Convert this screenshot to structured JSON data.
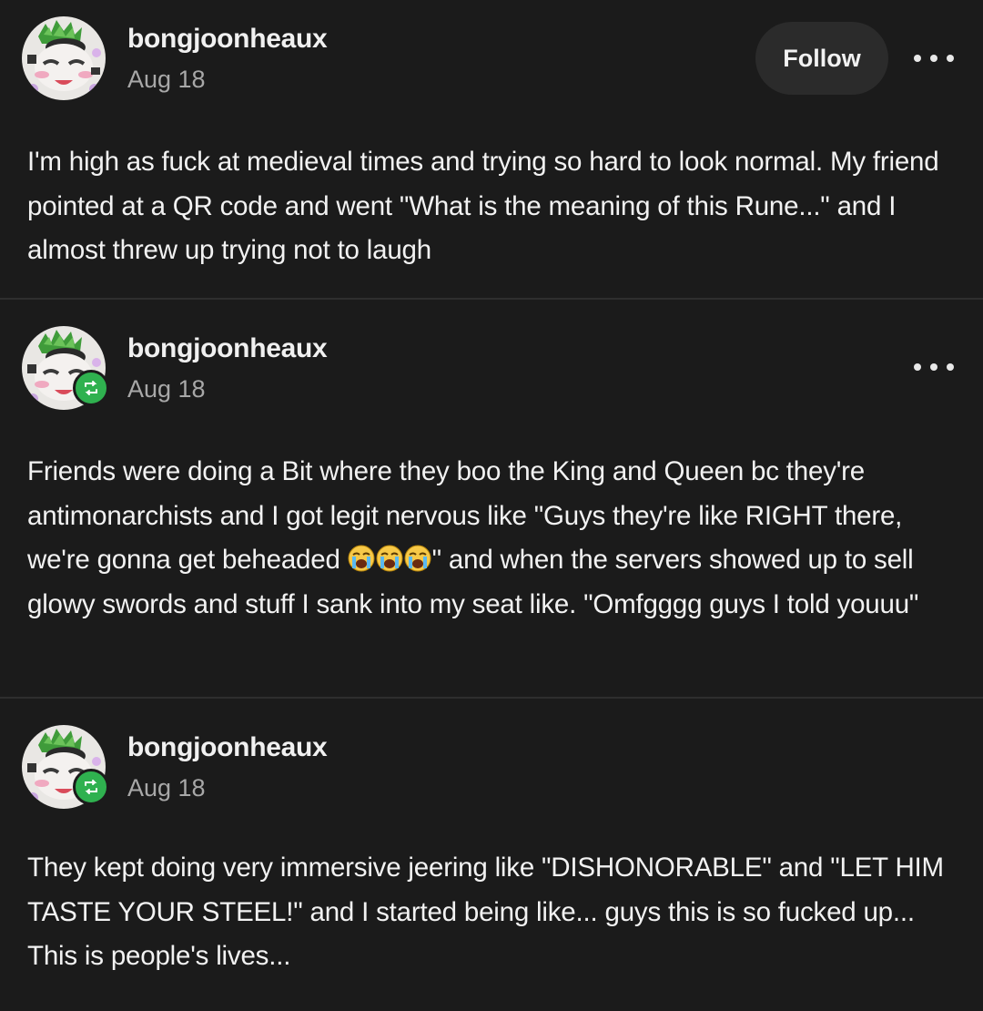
{
  "posts": [
    {
      "username": "bongjoonheaux",
      "date": "Aug 18",
      "follow_label": "Follow",
      "reblog": false,
      "body": "I'm high as fuck at medieval times and trying so hard to look normal. My friend pointed at a QR code and went \"What is the meaning of this Rune...\" and I almost threw up trying not to laugh"
    },
    {
      "username": "bongjoonheaux",
      "date": "Aug 18",
      "reblog": true,
      "body_before_emoji": "Friends were doing a Bit where they boo the King and Queen bc they're antimonarchists and I got legit nervous like \"Guys they're like RIGHT there, we're gonna get beheaded ",
      "emoji": "loudly-crying-face x3",
      "body_after_emoji": "\" and when the servers showed up to sell glowy swords and stuff I sank into my seat like. \"Omfgggg guys I told youuu\""
    },
    {
      "username": "bongjoonheaux",
      "date": "Aug 18",
      "reblog": true,
      "body": "They kept doing very immersive jeering like \"DISHONORABLE\" and \"LET HIM TASTE YOUR STEEL!\" and I started being like... guys this is so fucked up... This is people's lives..."
    }
  ],
  "colors": {
    "background": "#1b1b1b",
    "divider": "#2e2e2e",
    "follow_button": "#2b2b2b",
    "reblog_badge": "#2fb14f",
    "date_text": "#a8a8a8"
  },
  "icons": {
    "more": "more-horizontal-icon",
    "reblog": "reblog-icon",
    "emoji": "loudly-crying-face"
  }
}
